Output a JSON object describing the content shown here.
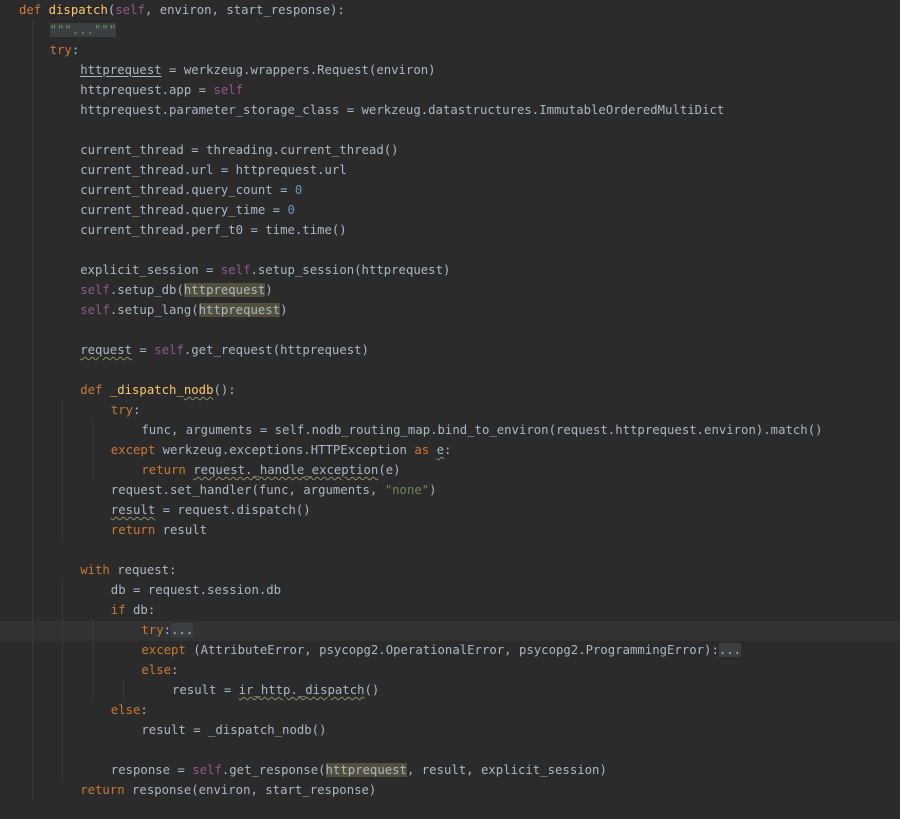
{
  "editor": {
    "lines": [
      {
        "indent": 0,
        "tokens": [
          {
            "t": "def ",
            "c": "kw"
          },
          {
            "t": "dispatch",
            "c": "fn"
          },
          {
            "t": "(",
            "c": "plain"
          },
          {
            "t": "self",
            "c": "self"
          },
          {
            "t": ", environ, start_response):",
            "c": "plain"
          }
        ]
      },
      {
        "indent": 1,
        "tokens": [
          {
            "t": "\"\"\"...\"\"\"",
            "c": "strfold"
          }
        ]
      },
      {
        "indent": 1,
        "tokens": [
          {
            "t": "try",
            "c": "kw"
          },
          {
            "t": ":",
            "c": "plain"
          }
        ]
      },
      {
        "indent": 2,
        "tokens": [
          {
            "t": "httprequest",
            "c": "plain",
            "d": "und"
          },
          {
            "t": " = werkzeug.wrappers.Request(environ)",
            "c": "plain"
          }
        ]
      },
      {
        "indent": 2,
        "tokens": [
          {
            "t": "httprequest.app = ",
            "c": "plain"
          },
          {
            "t": "self",
            "c": "self"
          }
        ]
      },
      {
        "indent": 2,
        "tokens": [
          {
            "t": "httprequest.parameter_storage_class = werkzeug.datastructures.ImmutableOrderedMultiDict",
            "c": "plain"
          }
        ]
      },
      {
        "indent": 0,
        "tokens": []
      },
      {
        "indent": 2,
        "tokens": [
          {
            "t": "current_thread = threading.current_thread()",
            "c": "plain"
          }
        ]
      },
      {
        "indent": 2,
        "tokens": [
          {
            "t": "current_thread.url = httprequest.url",
            "c": "plain"
          }
        ]
      },
      {
        "indent": 2,
        "tokens": [
          {
            "t": "current_thread.query_count = ",
            "c": "plain"
          },
          {
            "t": "0",
            "c": "num"
          }
        ]
      },
      {
        "indent": 2,
        "tokens": [
          {
            "t": "current_thread.query_time = ",
            "c": "plain"
          },
          {
            "t": "0",
            "c": "num"
          }
        ]
      },
      {
        "indent": 2,
        "tokens": [
          {
            "t": "current_thread.perf_t0 = time.time()",
            "c": "plain"
          }
        ]
      },
      {
        "indent": 0,
        "tokens": []
      },
      {
        "indent": 2,
        "tokens": [
          {
            "t": "explicit_session = ",
            "c": "plain"
          },
          {
            "t": "self",
            "c": "self"
          },
          {
            "t": ".setup_session(httprequest)",
            "c": "plain"
          }
        ]
      },
      {
        "indent": 2,
        "tokens": [
          {
            "t": "self",
            "c": "self"
          },
          {
            "t": ".setup_db(",
            "c": "plain"
          },
          {
            "t": "httprequest",
            "c": "plain",
            "d": "hl"
          },
          {
            "t": ")",
            "c": "plain"
          }
        ]
      },
      {
        "indent": 2,
        "tokens": [
          {
            "t": "self",
            "c": "self"
          },
          {
            "t": ".setup_lang(",
            "c": "plain"
          },
          {
            "t": "httprequest",
            "c": "plain",
            "d": "hl"
          },
          {
            "t": ")",
            "c": "plain"
          }
        ]
      },
      {
        "indent": 0,
        "tokens": []
      },
      {
        "indent": 2,
        "tokens": [
          {
            "t": "request",
            "c": "plain",
            "d": "squig"
          },
          {
            "t": " = ",
            "c": "plain"
          },
          {
            "t": "self",
            "c": "self"
          },
          {
            "t": ".get_request(httprequest)",
            "c": "plain"
          }
        ]
      },
      {
        "indent": 0,
        "tokens": []
      },
      {
        "indent": 2,
        "tokens": [
          {
            "t": "def ",
            "c": "kw"
          },
          {
            "t": "_dispatch_",
            "c": "fn"
          },
          {
            "t": "nodb",
            "c": "fn",
            "d": "squig"
          },
          {
            "t": "():",
            "c": "plain"
          }
        ]
      },
      {
        "indent": 3,
        "tokens": [
          {
            "t": "try",
            "c": "kw"
          },
          {
            "t": ":",
            "c": "plain"
          }
        ]
      },
      {
        "indent": 4,
        "tokens": [
          {
            "t": "func, arguments = self.nodb_routing_map.bind_to_environ(request.httprequest.environ).match()",
            "c": "plain"
          }
        ]
      },
      {
        "indent": 3,
        "tokens": [
          {
            "t": "except ",
            "c": "kw"
          },
          {
            "t": "werkzeug.exceptions.HTTPException ",
            "c": "plain"
          },
          {
            "t": "as ",
            "c": "kw"
          },
          {
            "t": "e",
            "c": "plain",
            "d": "squig"
          },
          {
            "t": ":",
            "c": "plain"
          }
        ]
      },
      {
        "indent": 4,
        "tokens": [
          {
            "t": "return ",
            "c": "kw"
          },
          {
            "t": "request._handle_exception",
            "c": "plain",
            "d": "squig"
          },
          {
            "t": "(e)",
            "c": "plain"
          }
        ]
      },
      {
        "indent": 3,
        "tokens": [
          {
            "t": "request.set_handler(func, arguments, ",
            "c": "plain"
          },
          {
            "t": "\"none\"",
            "c": "str"
          },
          {
            "t": ")",
            "c": "plain"
          }
        ]
      },
      {
        "indent": 3,
        "tokens": [
          {
            "t": "result",
            "c": "plain",
            "d": "squig"
          },
          {
            "t": " = request.dispatch()",
            "c": "plain"
          }
        ]
      },
      {
        "indent": 3,
        "tokens": [
          {
            "t": "return ",
            "c": "kw"
          },
          {
            "t": "result",
            "c": "plain"
          }
        ]
      },
      {
        "indent": 0,
        "tokens": []
      },
      {
        "indent": 2,
        "tokens": [
          {
            "t": "with ",
            "c": "kw"
          },
          {
            "t": "request:",
            "c": "plain"
          }
        ]
      },
      {
        "indent": 3,
        "tokens": [
          {
            "t": "db = request.session.db",
            "c": "plain"
          }
        ]
      },
      {
        "indent": 3,
        "tokens": [
          {
            "t": "if ",
            "c": "kw"
          },
          {
            "t": "db:",
            "c": "plain"
          }
        ]
      },
      {
        "indent": 4,
        "tokens": [
          {
            "t": "try",
            "c": "kw"
          },
          {
            "t": ":",
            "c": "plain"
          },
          {
            "t": "...",
            "c": "fold"
          }
        ]
      },
      {
        "indent": 4,
        "tokens": [
          {
            "t": "except ",
            "c": "kw"
          },
          {
            "t": "(AttributeError, psycopg2.OperationalError, psycopg2.ProgrammingError):",
            "c": "plain"
          },
          {
            "t": "...",
            "c": "fold"
          }
        ]
      },
      {
        "indent": 4,
        "tokens": [
          {
            "t": "else",
            "c": "kw"
          },
          {
            "t": ":",
            "c": "plain"
          }
        ]
      },
      {
        "indent": 5,
        "tokens": [
          {
            "t": "result = ",
            "c": "plain"
          },
          {
            "t": "ir_http._dispatch",
            "c": "plain",
            "d": "squig"
          },
          {
            "t": "()",
            "c": "plain"
          }
        ]
      },
      {
        "indent": 3,
        "tokens": [
          {
            "t": "else",
            "c": "kw"
          },
          {
            "t": ":",
            "c": "plain"
          }
        ]
      },
      {
        "indent": 4,
        "tokens": [
          {
            "t": "result = _dispatch_nodb()",
            "c": "plain"
          }
        ]
      },
      {
        "indent": 0,
        "tokens": []
      },
      {
        "indent": 3,
        "tokens": [
          {
            "t": "response = ",
            "c": "plain"
          },
          {
            "t": "self",
            "c": "self"
          },
          {
            "t": ".get_response(",
            "c": "plain"
          },
          {
            "t": "httprequest",
            "c": "plain",
            "d": "hl"
          },
          {
            "t": ", result, explicit_session)",
            "c": "plain"
          }
        ]
      },
      {
        "indent": 2,
        "tokens": [
          {
            "t": "return ",
            "c": "kw"
          },
          {
            "t": "response(environ, start_response)",
            "c": "plain"
          }
        ]
      }
    ]
  }
}
